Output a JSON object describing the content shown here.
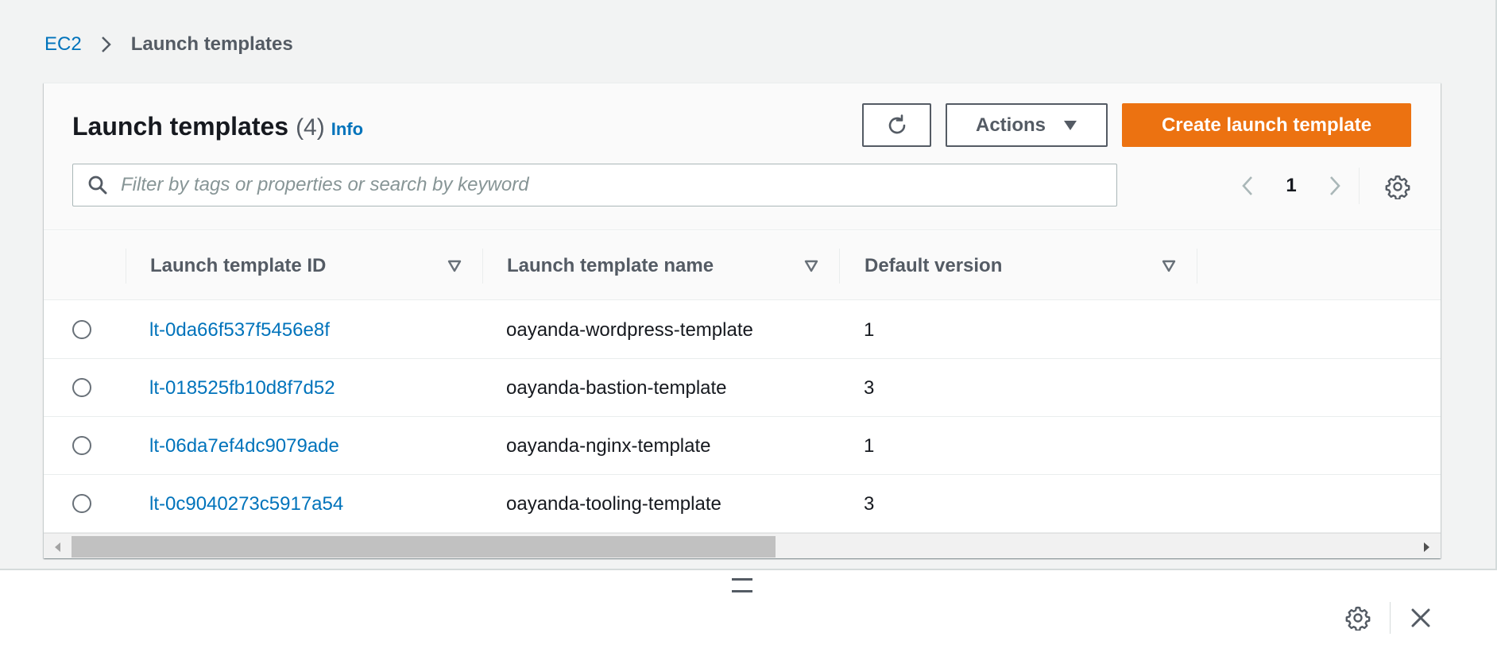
{
  "breadcrumb": {
    "root": "EC2",
    "current": "Launch templates"
  },
  "panel": {
    "title": "Launch templates",
    "count": "(4)",
    "info": "Info",
    "refresh_icon": "refresh-icon",
    "actions_label": "Actions",
    "create_label": "Create launch template",
    "search_placeholder": "Filter by tags or properties or search by keyword",
    "search_value": "",
    "page_number": "1"
  },
  "table": {
    "columns": [
      {
        "label": "Launch template ID"
      },
      {
        "label": "Launch template name"
      },
      {
        "label": "Default version"
      }
    ],
    "rows": [
      {
        "id": "lt-0da66f537f5456e8f",
        "name": "oayanda-wordpress-template",
        "version": "1"
      },
      {
        "id": "lt-018525fb10d8f7d52",
        "name": "oayanda-bastion-template",
        "version": "3"
      },
      {
        "id": "lt-06da7ef4dc9079ade",
        "name": "oayanda-nginx-template",
        "version": "1"
      },
      {
        "id": "lt-0c9040273c5917a54",
        "name": "oayanda-tooling-template",
        "version": "3"
      }
    ]
  },
  "colors": {
    "link": "#0073bb",
    "primary_button": "#ec7211",
    "background": "#f2f3f3",
    "text": "#16191f",
    "secondary_text": "#545b64"
  }
}
